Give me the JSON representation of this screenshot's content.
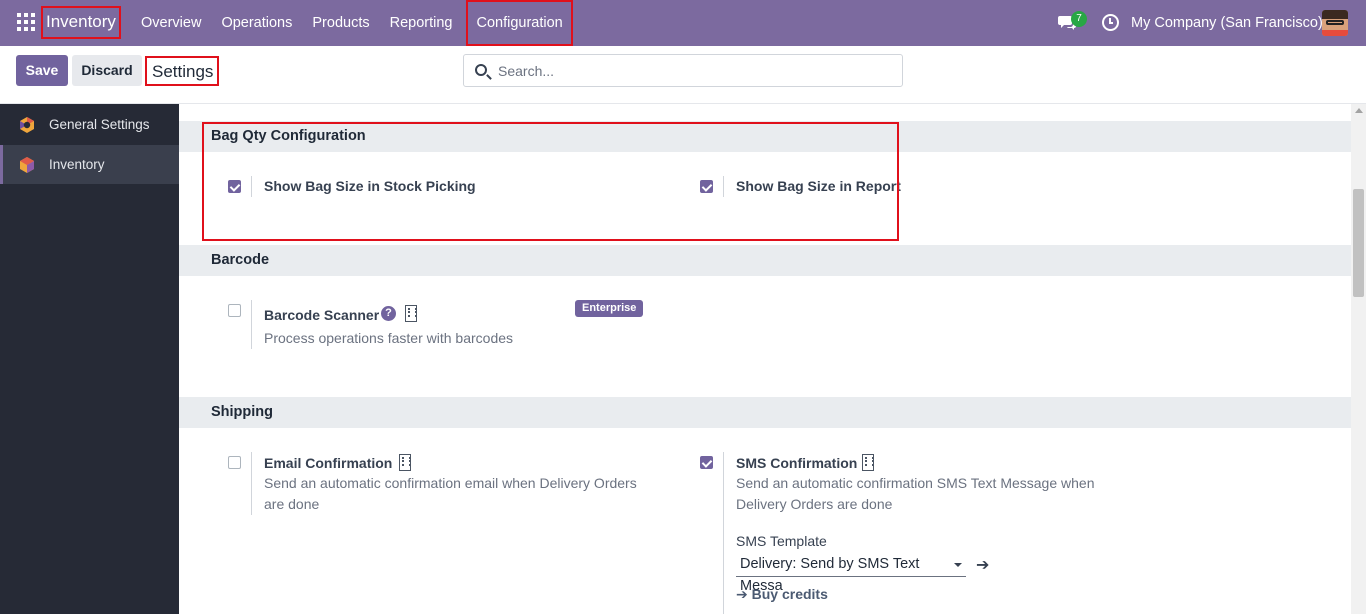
{
  "navbar": {
    "app_title": "Inventory",
    "menu": [
      "Overview",
      "Operations",
      "Products",
      "Reporting",
      "Configuration"
    ],
    "chat_count": "7",
    "company": "My Company (San Francisco)"
  },
  "control_panel": {
    "save_label": "Save",
    "discard_label": "Discard",
    "title": "Settings",
    "search_placeholder": "Search..."
  },
  "sidebar": {
    "items": [
      {
        "label": "General Settings",
        "icon": "odoo-settings-icon",
        "active": false
      },
      {
        "label": "Inventory",
        "icon": "inventory-app-icon",
        "active": true
      }
    ]
  },
  "sections": {
    "bag_qty": {
      "title": "Bag Qty Configuration",
      "settings": [
        {
          "label": "Show Bag Size in Stock Picking",
          "checked": true
        },
        {
          "label": "Show Bag Size in Report",
          "checked": true
        }
      ]
    },
    "barcode": {
      "title": "Barcode",
      "scanner": {
        "label": "Barcode Scanner",
        "checked": false,
        "description": "Process operations faster with barcodes",
        "badge": "Enterprise"
      }
    },
    "shipping": {
      "title": "Shipping",
      "email": {
        "label": "Email Confirmation",
        "checked": false,
        "description_line1": "Send an automatic confirmation email when Delivery Orders",
        "description_line2": "are done"
      },
      "sms": {
        "label": "SMS Confirmation",
        "checked": true,
        "description_line1": "Send an automatic confirmation SMS Text Message when",
        "description_line2": "Delivery Orders are done",
        "template_label": "SMS Template",
        "template_value": "Delivery: Send by SMS Text Messa",
        "buy_credits": "Buy credits"
      }
    }
  },
  "colors": {
    "navbar": "#7c6a9f",
    "primary": "#71639e",
    "sidebar": "#262a36",
    "highlight": "#e0101b"
  }
}
